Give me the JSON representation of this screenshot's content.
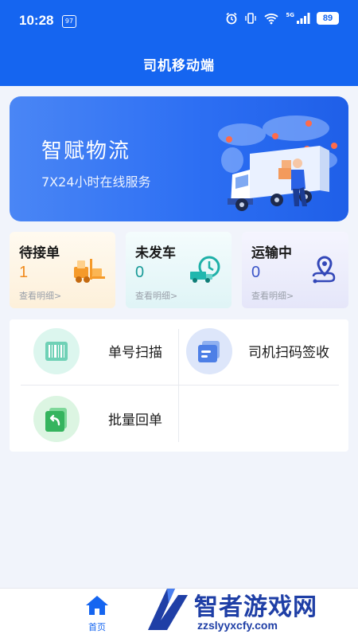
{
  "status_bar": {
    "time": "10:28",
    "app_icon_text": "97",
    "battery": "89",
    "network": "5G"
  },
  "header": {
    "title": "司机移动端"
  },
  "banner": {
    "title": "智赋物流",
    "subtitle": "7X24小时在线服务"
  },
  "stats": [
    {
      "label": "待接单",
      "count": "1",
      "detail": "查看明细>",
      "icon": "forklift-icon"
    },
    {
      "label": "未发车",
      "count": "0",
      "detail": "查看明细>",
      "icon": "truck-clock-icon"
    },
    {
      "label": "运输中",
      "count": "0",
      "detail": "查看明细>",
      "icon": "route-pin-icon"
    }
  ],
  "actions": [
    {
      "label": "单号扫描",
      "icon": "barcode-scan-icon"
    },
    {
      "label": "司机扫码签收",
      "icon": "document-sign-icon"
    },
    {
      "label": "批量回单",
      "icon": "return-receipt-icon"
    }
  ],
  "tabbar": {
    "home_label": "首页"
  },
  "watermark": {
    "text": "智者游戏网",
    "url": "zzslyyxcfy.com"
  },
  "colors": {
    "primary": "#1565f0",
    "pending": "#f08a1c",
    "not_departed": "#1a9b98",
    "in_transit": "#3b55c8"
  }
}
